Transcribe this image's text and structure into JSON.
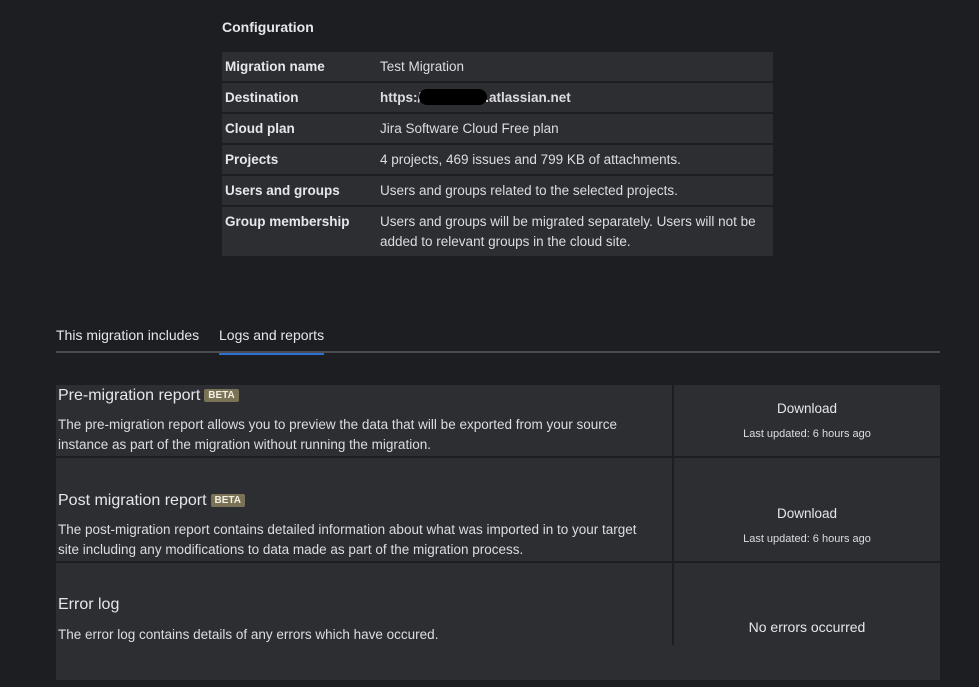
{
  "configuration": {
    "title": "Configuration",
    "rows": [
      {
        "label": "Migration name",
        "value": "Test Migration"
      },
      {
        "label": "Destination",
        "value_prefix": "https:/",
        "value_suffix": ".atlassian.net"
      },
      {
        "label": "Cloud plan",
        "value": "Jira Software Cloud Free plan"
      },
      {
        "label": "Projects",
        "value": "4 projects, 469 issues and 799 KB of attachments."
      },
      {
        "label": "Users and groups",
        "value": "Users and groups related to the selected projects."
      },
      {
        "label": "Group membership",
        "value": "Users and groups will be migrated separately. Users will not be added to relevant groups in the cloud site."
      }
    ]
  },
  "tabs": [
    {
      "label": "This migration includes",
      "active": false
    },
    {
      "label": "Logs and reports",
      "active": true
    }
  ],
  "reports": {
    "pre": {
      "title": "Pre-migration report",
      "badge": "BETA",
      "description": "The pre-migration report allows you to preview the data that will be exported from your source instance as part of the migration without running the migration.",
      "action": "Download",
      "updated": "Last updated: 6 hours ago"
    },
    "post": {
      "title": "Post migration report",
      "badge": "BETA",
      "description": "The post-migration report contains detailed information about what was imported in to your target site including any modifications to data made as part of the migration process.",
      "action": "Download",
      "updated": "Last updated: 6 hours ago"
    },
    "error": {
      "title": "Error log",
      "description": "The error log contains details of any errors which have occured.",
      "status": "No errors occurred"
    }
  },
  "colors": {
    "background": "#1d1e21",
    "panel": "#2d2e32",
    "tab_underline": "#2f6fd6",
    "badge": "#7a7256"
  }
}
